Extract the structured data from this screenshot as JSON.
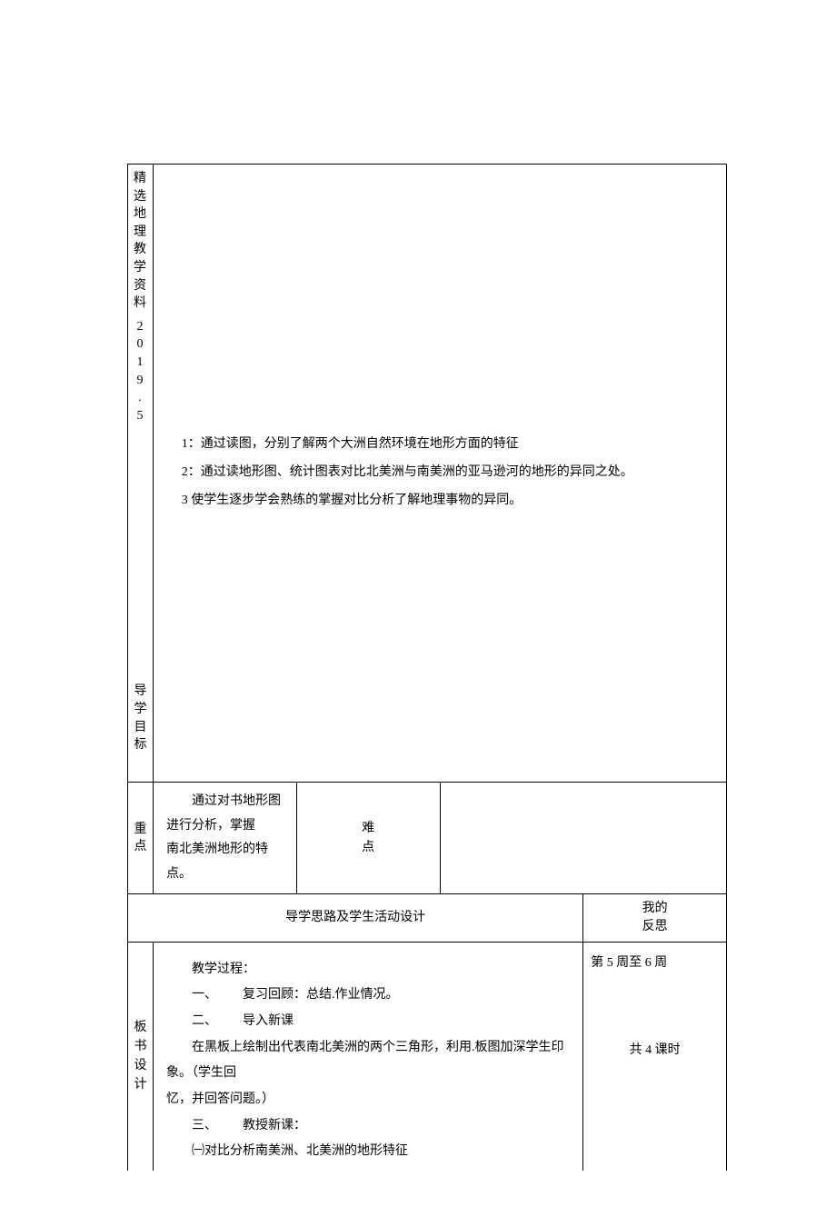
{
  "brand": {
    "title_chars": [
      "精",
      "选",
      "地",
      "理",
      "教",
      "学",
      "资",
      "料"
    ],
    "year": [
      "2",
      "0",
      "1",
      "9",
      ".",
      "5"
    ]
  },
  "labels": {
    "goal": [
      "导",
      "学",
      "目",
      "标"
    ],
    "key": [
      "重",
      "点"
    ],
    "difficult": [
      "难",
      "点"
    ],
    "design_header": "导学思路及学生活动设计",
    "reflection": [
      "我的",
      "反思"
    ],
    "board": [
      "板",
      "书",
      "设",
      "计"
    ]
  },
  "goals": {
    "g1": "1：通过读图，分别了解两个大洲自然环境在地形方面的特征",
    "g2": "2：通过读地形图、统计图表对比北美洲与南美洲的亚马逊河的地形的异同之处。",
    "g3": "3 使学生逐步学会熟练的掌握对比分析了解地理事物的异同。"
  },
  "keypoint": {
    "line1": "通过对书地形图进行分析，掌握",
    "line2": "南北美洲地形的特点。"
  },
  "difficulty": "",
  "process": {
    "p0": "教学过程：",
    "p1": "一、  复习回顾：总结.作业情况。",
    "p2": "二、  导入新课",
    "p3": "在黑板上绘制出代表南北美洲的两个三角形，利用.板图加深学生印象。（学生回",
    "p3b": "忆，并回答问题。）",
    "p4": "三、  教授新课：",
    "p5": "㈠对比分析南美洲、北美洲的地形特征"
  },
  "schedule": {
    "week": "第 5 周至 6 周",
    "periods": "共 4 课时"
  }
}
